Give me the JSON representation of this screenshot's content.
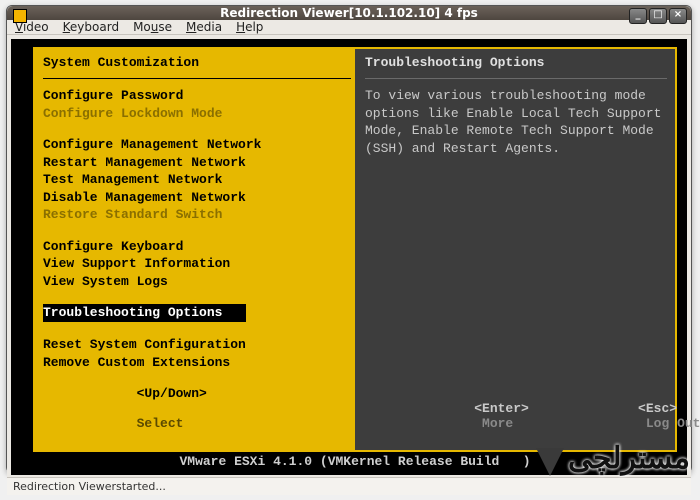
{
  "window": {
    "title": "Redirection Viewer[10.1.102.10]  4 fps",
    "controls": {
      "min": "_",
      "max": "□",
      "close": "×"
    }
  },
  "menubar": {
    "items": [
      "Video",
      "Keyboard",
      "Mouse",
      "Media",
      "Help"
    ]
  },
  "left": {
    "header": "System Customization",
    "groups": [
      [
        {
          "label": "Configure Password",
          "disabled": false
        },
        {
          "label": "Configure Lockdown Mode",
          "disabled": true
        }
      ],
      [
        {
          "label": "Configure Management Network",
          "disabled": false
        },
        {
          "label": "Restart Management Network",
          "disabled": false
        },
        {
          "label": "Test Management Network",
          "disabled": false
        },
        {
          "label": "Disable Management Network",
          "disabled": false
        },
        {
          "label": "Restore Standard Switch",
          "disabled": true
        }
      ],
      [
        {
          "label": "Configure Keyboard",
          "disabled": false
        },
        {
          "label": "View Support Information",
          "disabled": false
        },
        {
          "label": "View System Logs",
          "disabled": false
        }
      ],
      [
        {
          "label": "Troubleshooting Options",
          "disabled": false,
          "selected": true
        }
      ],
      [
        {
          "label": "Reset System Configuration",
          "disabled": false
        },
        {
          "label": "Remove Custom Extensions",
          "disabled": false
        }
      ]
    ],
    "footer": {
      "keys": "<Up/Down>",
      "action": "Select"
    }
  },
  "right": {
    "header": "Troubleshooting Options",
    "body": "To view various troubleshooting mode options like Enable Local Tech Support Mode, Enable Remote Tech Support Mode (SSH) and Restart Agents.",
    "footer": {
      "enter_key": "<Enter>",
      "enter_action": "More",
      "esc_key": "<Esc>",
      "esc_action": "Log Out"
    }
  },
  "console_footer": "VMware ESXi 4.1.0 (VMKernel Release Build   )",
  "statusbar": "Redirection Viewerstarted...",
  "watermark": "مسترلچی"
}
